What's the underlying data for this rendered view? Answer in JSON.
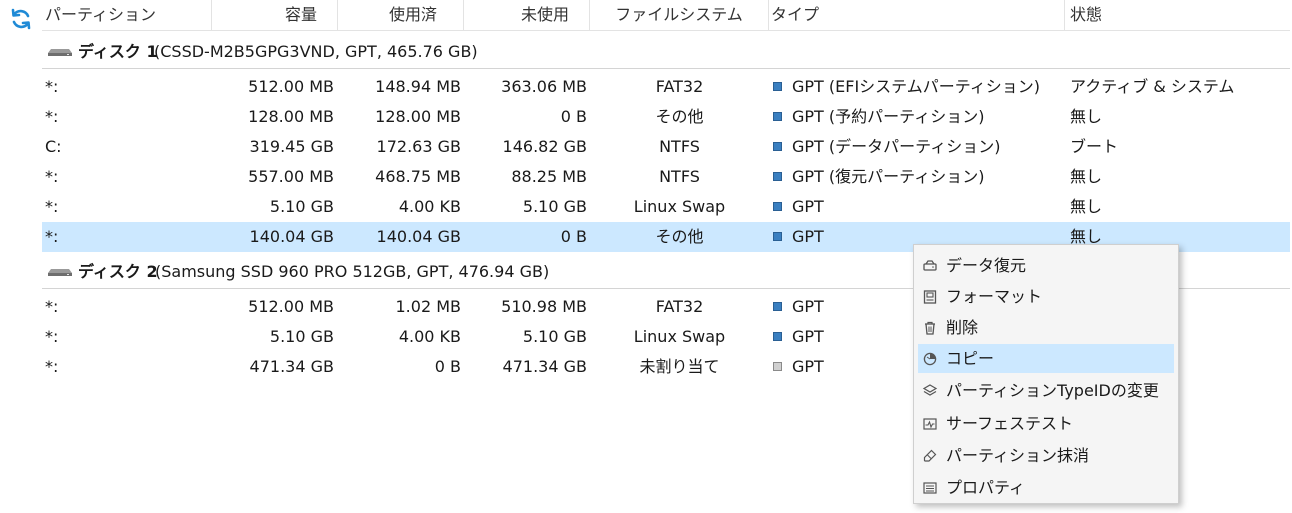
{
  "toolbar": {
    "refresh_icon": "refresh-icon"
  },
  "columns": [
    "パーティション",
    "容量",
    "使用済",
    "未使用",
    "ファイルシステム",
    "タイプ",
    "状態"
  ],
  "disks": [
    {
      "label": "ディスク 1",
      "info": "(CSSD-M2B5GPG3VND, GPT, 465.76 GB)",
      "partitions": [
        {
          "name": "*:",
          "capacity": "512.00 MB",
          "used": "148.94 MB",
          "unused": "363.06 MB",
          "fs": "FAT32",
          "type": "GPT (EFIシステムパーティション)",
          "status": "アクティブ & システム",
          "color": "#3a7fc0"
        },
        {
          "name": "*:",
          "capacity": "128.00 MB",
          "used": "128.00 MB",
          "unused": "0 B",
          "fs": "その他",
          "type": "GPT (予約パーティション)",
          "status": "無し",
          "color": "#3a7fc0"
        },
        {
          "name": "C:",
          "capacity": "319.45 GB",
          "used": "172.63 GB",
          "unused": "146.82 GB",
          "fs": "NTFS",
          "type": "GPT (データパーティション)",
          "status": "ブート",
          "color": "#3a7fc0"
        },
        {
          "name": "*:",
          "capacity": "557.00 MB",
          "used": "468.75 MB",
          "unused": "88.25 MB",
          "fs": "NTFS",
          "type": "GPT (復元パーティション)",
          "status": "無し",
          "color": "#3a7fc0"
        },
        {
          "name": "*:",
          "capacity": "5.10 GB",
          "used": "4.00 KB",
          "unused": "5.10 GB",
          "fs": "Linux Swap",
          "type": "GPT",
          "status": "無し",
          "color": "#3a7fc0"
        },
        {
          "name": "*:",
          "capacity": "140.04 GB",
          "used": "140.04 GB",
          "unused": "0 B",
          "fs": "その他",
          "type": "GPT",
          "status": "無し",
          "color": "#3a7fc0",
          "selected": true
        }
      ]
    },
    {
      "label": "ディスク 2",
      "info": "(Samsung SSD 960 PRO 512GB, GPT, 476.94 GB)",
      "partitions": [
        {
          "name": "*:",
          "capacity": "512.00 MB",
          "used": "1.02 MB",
          "unused": "510.98 MB",
          "fs": "FAT32",
          "type": "GPT",
          "status": "",
          "color": "#3a7fc0"
        },
        {
          "name": "*:",
          "capacity": "5.10 GB",
          "used": "4.00 KB",
          "unused": "5.10 GB",
          "fs": "Linux Swap",
          "type": "GPT",
          "status": "",
          "color": "#3a7fc0"
        },
        {
          "name": "*:",
          "capacity": "471.34 GB",
          "used": "0 B",
          "unused": "471.34 GB",
          "fs": "未割り当て",
          "type": "GPT",
          "status": "",
          "color": "#d0d0d0"
        }
      ]
    }
  ],
  "context_menu": {
    "items": [
      {
        "label": "データ復元",
        "icon": "data-recovery-icon"
      },
      {
        "label": "フォーマット",
        "icon": "format-icon"
      },
      {
        "label": "削除",
        "icon": "trash-icon"
      },
      {
        "label": "コピー",
        "icon": "copy-icon",
        "highlighted": true
      },
      {
        "label": "パーティションTypeIDの変更",
        "icon": "layers-icon"
      },
      {
        "label": "サーフェステスト",
        "icon": "surface-test-icon"
      },
      {
        "label": "パーティション抹消",
        "icon": "eraser-icon"
      },
      {
        "label": "プロパティ",
        "icon": "properties-icon"
      }
    ]
  }
}
